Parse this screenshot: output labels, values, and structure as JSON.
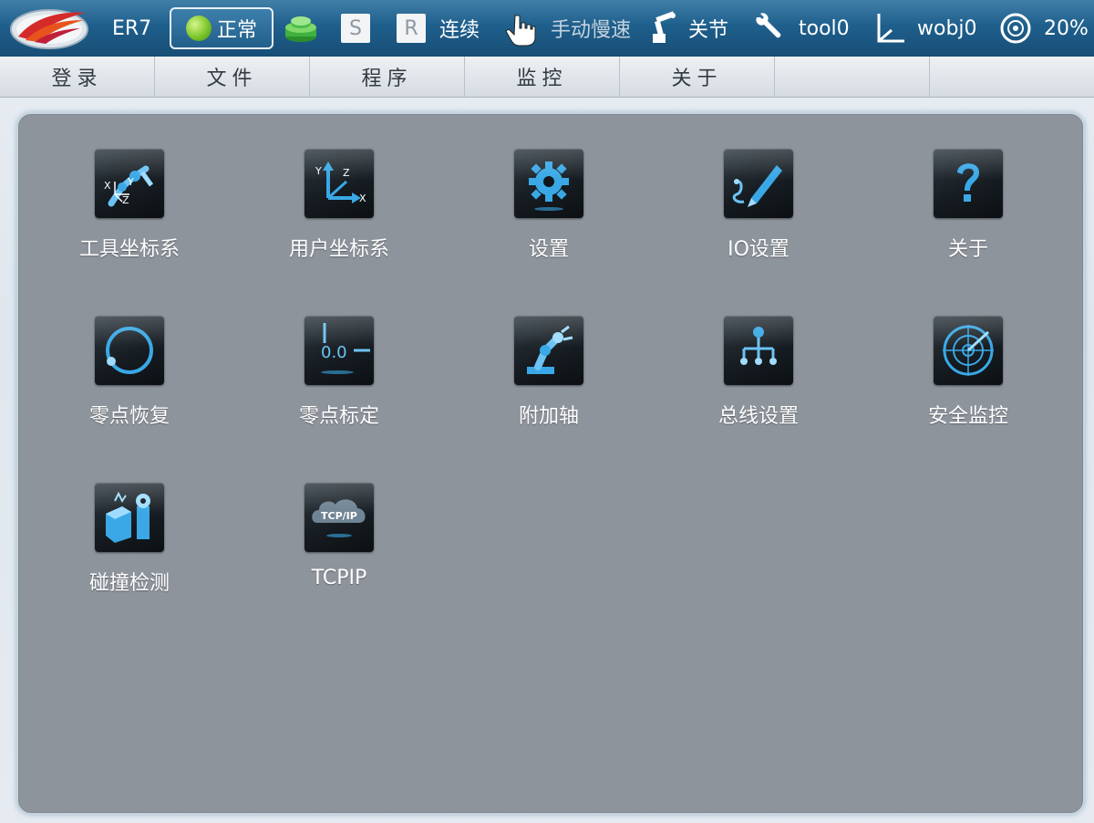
{
  "topbar": {
    "robot_name": "ER7",
    "status_label": "正常",
    "s_label": "S",
    "r_label": "R",
    "run_mode": "连续",
    "manual_mode": "手动慢速",
    "jog_mode": "关节",
    "tool": "tool0",
    "wobj": "wobj0",
    "speed": "20%"
  },
  "menu": {
    "items": [
      "登录",
      "文件",
      "程序",
      "监控",
      "关于",
      "",
      ""
    ]
  },
  "tiles": [
    {
      "label": "工具坐标系",
      "icon": "tool-frame-icon"
    },
    {
      "label": "用户坐标系",
      "icon": "user-frame-icon"
    },
    {
      "label": "设置",
      "icon": "gear-icon"
    },
    {
      "label": "IO设置",
      "icon": "io-pen-icon"
    },
    {
      "label": "关于",
      "icon": "question-icon"
    },
    {
      "label": "零点恢复",
      "icon": "zero-restore-icon"
    },
    {
      "label": "零点标定",
      "icon": "zero-calibrate-icon"
    },
    {
      "label": "附加轴",
      "icon": "robot-arm-icon"
    },
    {
      "label": "总线设置",
      "icon": "bus-tree-icon"
    },
    {
      "label": "安全监控",
      "icon": "radar-icon"
    },
    {
      "label": "碰撞检测",
      "icon": "collision-icon"
    },
    {
      "label": "TCPIP",
      "icon": "tcpip-cloud-icon"
    }
  ],
  "icon_texts": {
    "tcpip": "TCP/IP",
    "zero": "0.0"
  },
  "colors": {
    "accent_blue": "#3aa8e6",
    "panel_bg": "#8e949c",
    "topbar_bg": "#1f5f8c"
  }
}
